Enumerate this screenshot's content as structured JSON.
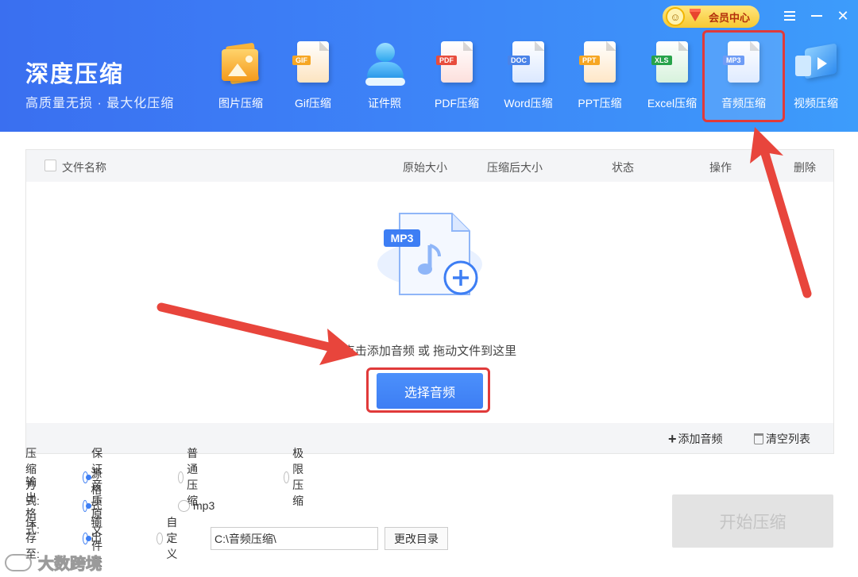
{
  "brand": {
    "title": "深度压缩",
    "subtitle": "高质量无损 · 最大化压缩"
  },
  "vip": {
    "label": "会员中心"
  },
  "tools": [
    {
      "label": "图片压缩",
      "icon": "image-compress-icon"
    },
    {
      "label": "Gif压缩",
      "icon": "gif-compress-icon",
      "tag": "GIF"
    },
    {
      "label": "证件照",
      "icon": "id-photo-icon"
    },
    {
      "label": "PDF压缩",
      "icon": "pdf-compress-icon",
      "tag": "PDF"
    },
    {
      "label": "Word压缩",
      "icon": "word-compress-icon",
      "tag": "DOC"
    },
    {
      "label": "PPT压缩",
      "icon": "ppt-compress-icon",
      "tag": "PPT"
    },
    {
      "label": "Excel压缩",
      "icon": "excel-compress-icon",
      "tag": "XLS"
    },
    {
      "label": "音频压缩",
      "icon": "audio-compress-icon",
      "tag": "MP3"
    },
    {
      "label": "视频压缩",
      "icon": "video-compress-icon"
    }
  ],
  "table": {
    "columns": [
      "文件名称",
      "原始大小",
      "压缩后大小",
      "状态",
      "操作",
      "删除"
    ],
    "drop_hint": "点击添加音频 或 拖动文件到这里",
    "drop_icon_tag": "MP3",
    "select_button": "选择音频",
    "add_audio": "添加音频",
    "clear_list": "清空列表"
  },
  "options": {
    "compress_mode_label": "压缩方式:",
    "compress_modes": [
      "保证音质",
      "普通压缩",
      "极限压缩"
    ],
    "output_format_label": "输出格式:",
    "output_formats": [
      "源格式输出",
      "mp3"
    ],
    "save_to_label": "保存至:",
    "save_options": [
      "原文件夹",
      "自定义"
    ],
    "save_path": "C:\\音频压缩\\",
    "change_dir": "更改目录"
  },
  "start_button": "开始压缩",
  "watermark": "大数跨境",
  "colors": {
    "primary": "#3d7ef4",
    "highlight": "#e03a3a",
    "header_start": "#3a6ff0",
    "header_end": "#3d9cfb"
  }
}
